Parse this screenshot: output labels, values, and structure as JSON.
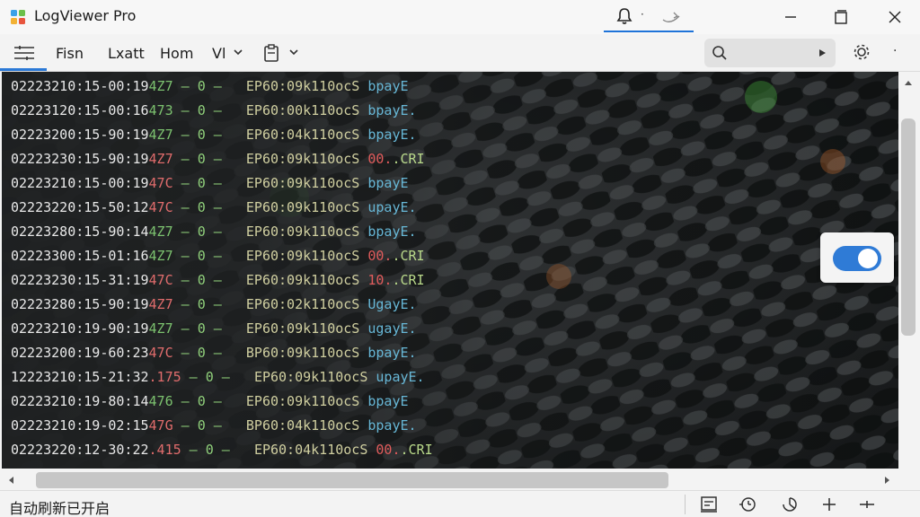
{
  "app": {
    "title": "LogViewer Pro",
    "accent": "#2f7bd6"
  },
  "titlebar": {
    "notification_dot": "·",
    "window_buttons": [
      "minimize-icon",
      "maximize-icon",
      "close-icon"
    ]
  },
  "menubar": {
    "items": [
      {
        "label": "Fisn"
      },
      {
        "label": "Lxatt"
      },
      {
        "label": "Hom"
      },
      {
        "label": "Vl"
      }
    ],
    "more_label": "·"
  },
  "log": {
    "lines": [
      {
        "ts": "02223210:15-00:19",
        "thread": "4Z7",
        "thread_color": "green",
        "sep": " – 0 –",
        "code": "EP60:09k110ocS",
        "msg": " bpayE",
        "level": "info"
      },
      {
        "ts": "02223120:15-00:16",
        "thread": "473",
        "thread_color": "green",
        "sep": " – 0 –",
        "code": "EP60:00k110ocS",
        "msg": " bpayE.",
        "level": "info"
      },
      {
        "ts": "02223200:15-90:19",
        "thread": "4Z7",
        "thread_color": "green",
        "sep": " – 0 –",
        "code": "EP60:04k110ocS",
        "msg": " bpayE.",
        "level": "info"
      },
      {
        "ts": "02223230:15-90:19",
        "thread": "4Z7",
        "thread_color": "red",
        "sep": " – 0 –",
        "code": "EP60:09k110ocS",
        "msg": " 00.",
        "extra": ".CRI",
        "level": "error"
      },
      {
        "ts": "02223210:15-00:19",
        "thread": "47C",
        "thread_color": "red",
        "sep": " – 0 –",
        "code": "EP60:09k110ocS",
        "msg": " bpayE",
        "level": "info"
      },
      {
        "ts": "02223220:15-50:12",
        "thread": "47C",
        "thread_color": "red",
        "sep": " – 0 –",
        "code": "EP60:09k110ocS",
        "msg": " upayE.",
        "level": "info"
      },
      {
        "ts": "02223280:15-90:14",
        "thread": "4Z7",
        "thread_color": "green",
        "sep": " – 0 –",
        "code": "EP60:09k110ocS",
        "msg": " bpayE.",
        "level": "info"
      },
      {
        "ts": "02223300:15-01:16",
        "thread": "4Z7",
        "thread_color": "green",
        "sep": " – 0 –",
        "code": "EP60:09k110ocS",
        "msg": " 00.",
        "extra": ".CRI",
        "level": "error"
      },
      {
        "ts": "02223230:15-31:19",
        "thread": "47C",
        "thread_color": "red",
        "sep": " – 0 –",
        "code": "EP60:09k110ocS",
        "msg": " 10.",
        "extra": ".CRI",
        "level": "error"
      },
      {
        "ts": "02223280:15-90:19",
        "thread": "4Z7",
        "thread_color": "red",
        "sep": " – 0 –",
        "code": "EP60:02k110ocS",
        "msg": " UgayE.",
        "level": "info"
      },
      {
        "ts": "02223210:19-90:19",
        "thread": "4Z7",
        "thread_color": "green",
        "sep": " – 0 –",
        "code": "EP60:09k110ocS",
        "msg": " ugayE.",
        "level": "info"
      },
      {
        "ts": "02223200:19-60:23",
        "thread": "47C",
        "thread_color": "red",
        "sep": " – 0 –",
        "code": "BP60:09k110ocS",
        "msg": " bpayE.",
        "level": "info"
      },
      {
        "ts": "12223210:15-21:32",
        "thread": ".175",
        "thread_color": "red",
        "sep": " – 0 –",
        "code": "EP60:09k110ocS",
        "msg": " upayE.",
        "level": "info"
      },
      {
        "ts": "02223210:19-80:14",
        "thread": "476",
        "thread_color": "green",
        "sep": " – 0 –",
        "code": "EP60:09k110ocS",
        "msg": " bpayE",
        "level": "info"
      },
      {
        "ts": "02223210:19-02:15",
        "thread": "47G",
        "thread_color": "red",
        "sep": " – 0 –",
        "code": "BP60:04k110ocS",
        "msg": " bpayE.",
        "level": "info"
      },
      {
        "ts": "02223220:12-30:22",
        "thread": ".415",
        "thread_color": "red",
        "sep": " – 0 –",
        "code": "EP60:04k110ocS",
        "msg": " 00.",
        "extra": ".CRI",
        "level": "error"
      }
    ]
  },
  "toggle": {
    "state": "on"
  },
  "status": {
    "text": "自动刷新已开启",
    "icons": [
      "export-icon",
      "history-icon",
      "timer-icon",
      "add-icon",
      "split-icon"
    ]
  }
}
